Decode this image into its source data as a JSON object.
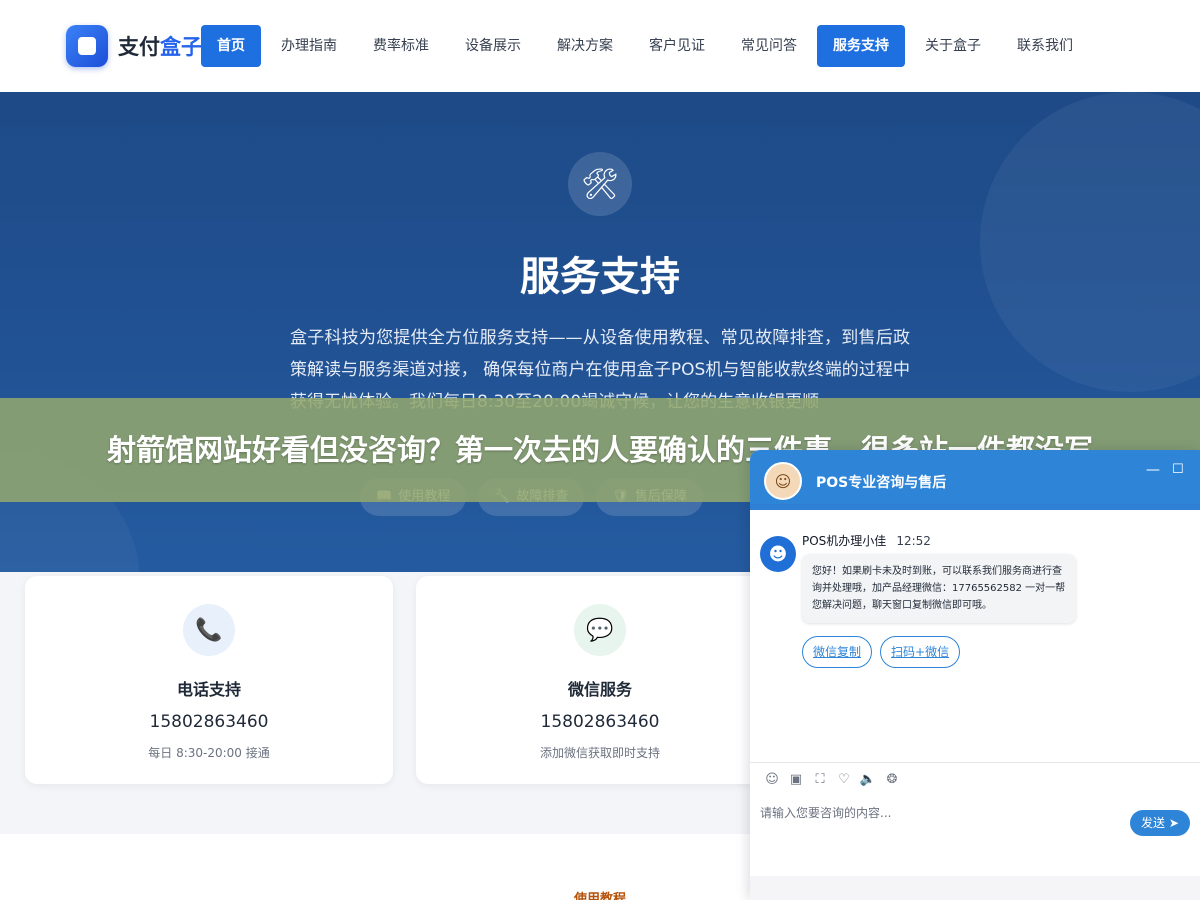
{
  "header": {
    "logo_text_main": "支付",
    "logo_text_accent": "盒子",
    "nav": [
      {
        "label": "首页",
        "active": true
      },
      {
        "label": "办理指南",
        "active": false
      },
      {
        "label": "费率标准",
        "active": false
      },
      {
        "label": "设备展示",
        "active": false
      },
      {
        "label": "解决方案",
        "active": false
      },
      {
        "label": "客户见证",
        "active": false
      },
      {
        "label": "常见问答",
        "active": false
      },
      {
        "label": "服务支持",
        "active": true
      },
      {
        "label": "关于盒子",
        "active": false
      },
      {
        "label": "联系我们",
        "active": false
      }
    ]
  },
  "hero": {
    "icon": "tools-icon",
    "title": "服务支持",
    "description": "盒子科技为您提供全方位服务支持——从设备使用教程、常见故障排查，到售后政策解读与服务渠道对接， 确保每位商户在使用盒子POS机与智能收款终端的过程中获得无忧体验。我们每日8:30至20:00竭诚守候，让您的生意收银更顺",
    "tags": [
      {
        "icon": "book-icon",
        "label": "使用教程"
      },
      {
        "icon": "wrench-icon",
        "label": "故障排查"
      },
      {
        "icon": "shield-icon",
        "label": "售后保障"
      }
    ]
  },
  "overlay": {
    "text": "射箭馆网站好看但没咨询？第一次去的人要确认的三件事，很多站一件都没写"
  },
  "cards": [
    {
      "icon": "phone-icon",
      "title": "电话支持",
      "value": "15802863460",
      "note": "每日 8:30-20:00 接通"
    },
    {
      "icon": "chat-icon",
      "title": "微信服务",
      "value": "15802863460",
      "note": "添加微信获取即时支持"
    }
  ],
  "bottom_section": {
    "label": "使用教程"
  },
  "chat": {
    "title": "POS专业咨询与售后",
    "agent_name": "POS机办理小佳",
    "time": "12:52",
    "message": "您好！如果刷卡未及时到账，可以联系我们服务商进行查询并处理哦，加产品经理微信：17765562582 一对一帮您解决问题，聊天窗口复制微信即可哦。",
    "quick_buttons": [
      "微信复制",
      "扫码+微信"
    ],
    "input_placeholder": "请输入您要咨询的内容...",
    "send_label": "发送"
  },
  "colors": {
    "brand_blue": "#1e6fe0",
    "hero_bg": "#215294",
    "overlay_bg": "#92a66e",
    "chat_blue": "#2e85d8"
  }
}
